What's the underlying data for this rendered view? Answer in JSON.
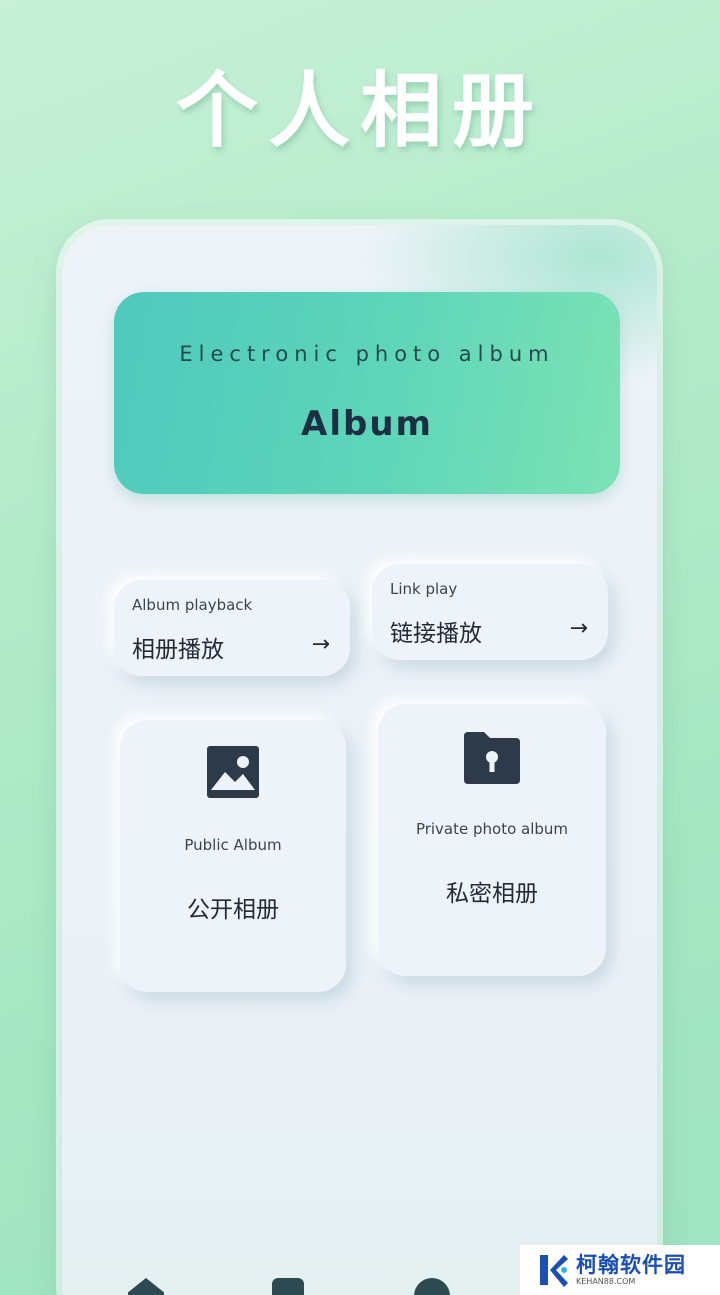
{
  "hero": {
    "title": "个人相册"
  },
  "banner": {
    "subtitle": "Electronic photo album",
    "title": "Album"
  },
  "links": [
    {
      "en": "Album playback",
      "zh": "相册播放",
      "arrow": "→"
    },
    {
      "en": "Link play",
      "zh": "链接播放",
      "arrow": "→"
    }
  ],
  "albums": [
    {
      "en": "Public Album",
      "zh": "公开相册",
      "icon": "image-icon"
    },
    {
      "en": "Private photo album",
      "zh": "私密相册",
      "icon": "locked-folder-icon"
    }
  ],
  "watermark": {
    "cn": "柯翰软件园",
    "en": "KEHAN88.COM"
  },
  "colors": {
    "accent": "#4ec9bd",
    "icon": "#2d3a4a"
  }
}
